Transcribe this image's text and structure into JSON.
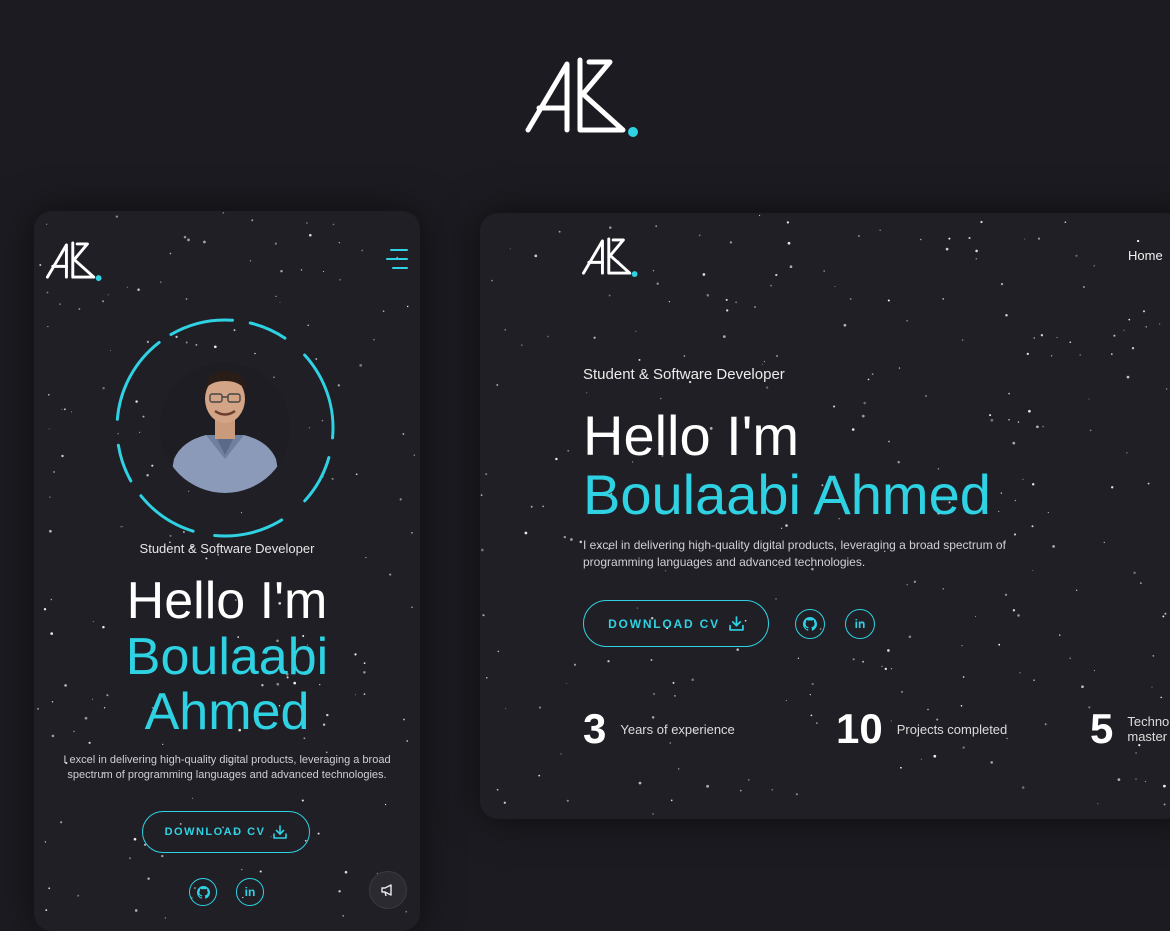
{
  "colors": {
    "accent": "#2fd2e3",
    "background": "#1c1b21",
    "card": "#201f25",
    "text": "#ffffff"
  },
  "brand": {
    "logo_icon": "ak-monogram-logo"
  },
  "mobile": {
    "menu_icon": "hamburger-menu-icon",
    "role": "Student & Software Developer",
    "hello": "Hello I'm",
    "name_line1": "Boulaabi",
    "name_line2": "Ahmed",
    "description": "I excel in delivering high-quality digital products, leveraging a broad spectrum of programming languages and advanced technologies.",
    "cv_label": "DOWNLOAD CV",
    "cv_icon": "download-icon",
    "github_icon": "github-icon",
    "linkedin_label": "in",
    "fab_icon": "megaphone-icon"
  },
  "desktop": {
    "nav": {
      "home": "Home"
    },
    "role": "Student & Software Developer",
    "hello": "Hello I'm",
    "name": "Boulaabi Ahmed",
    "description": "I excel in delivering high-quality digital products, leveraging a broad spectrum of programming languages and advanced technologies.",
    "cv_label": "DOWNLOAD CV",
    "linkedin_label": "in",
    "stats": [
      {
        "number": "3",
        "label": "Years of experience"
      },
      {
        "number": "10",
        "label": "Projects completed"
      },
      {
        "number": "5",
        "label_line1": "Techno",
        "label_line2": "master"
      }
    ]
  }
}
